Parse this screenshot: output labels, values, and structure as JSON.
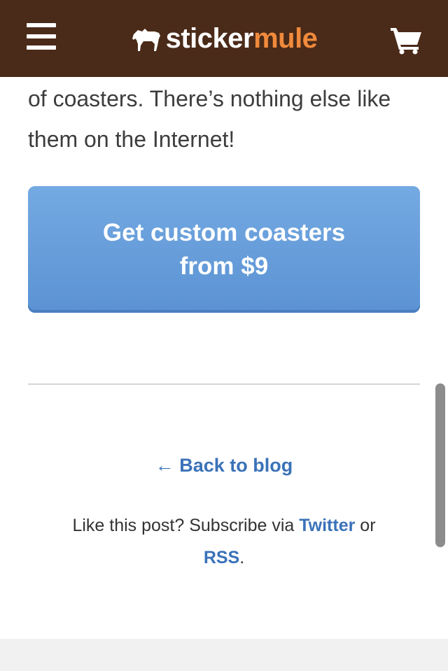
{
  "header": {
    "logo_sticker": "sticker",
    "logo_mule": "mule",
    "brand_color": "#4a2a18",
    "accent_color": "#f08a3c",
    "menu_icon": "hamburger-menu-icon",
    "cart_icon": "shopping-cart-icon"
  },
  "article": {
    "text": "of coasters. There’s nothing else like them on the Internet!"
  },
  "cta": {
    "line1": "Get custom coasters",
    "line2": "from $9",
    "color": "#6aa0dc"
  },
  "footer_links": {
    "back": "← Back to blog",
    "subscribe_prefix": "Like this post? Subscribe via",
    "twitter": "Twitter",
    "or": "or",
    "rss": "RSS",
    "period": ".",
    "link_color": "#3a72b8"
  }
}
